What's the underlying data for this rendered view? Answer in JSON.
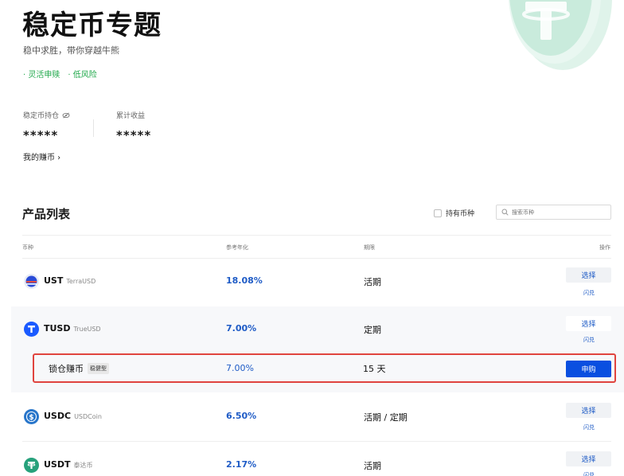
{
  "hero": {
    "title": "稳定币专题",
    "subtitle": "稳中求胜，带你穿越牛熊",
    "tags": [
      "灵活申赎",
      "低风险"
    ]
  },
  "holdings": {
    "holding_label": "稳定币持仓",
    "holding_value": "*****",
    "earnings_label": "累计收益",
    "earnings_value": "*****",
    "my_earn_link": "我的赚币 ›"
  },
  "products": {
    "title": "产品列表",
    "filter_label": "持有币种",
    "search_placeholder": "搜索币种",
    "columns": {
      "coin": "币种",
      "apy": "参考年化",
      "term": "期限",
      "action": "操作"
    },
    "rows": [
      {
        "symbol": "UST",
        "name": "TerraUSD",
        "apy": "18.08%",
        "term": "活期",
        "choose": "选择",
        "flash": "闪兑"
      },
      {
        "symbol": "TUSD",
        "name": "TrueUSD",
        "apy": "7.00%",
        "term": "定期",
        "choose": "选择",
        "flash": "闪兑"
      },
      {
        "symbol": "USDC",
        "name": "USDCoin",
        "apy": "6.50%",
        "term": "活期 / 定期",
        "choose": "选择",
        "flash": "闪兑"
      },
      {
        "symbol": "USDT",
        "name": "泰达币",
        "apy": "2.17%",
        "term": "活期",
        "choose": "选择",
        "flash": "闪兑"
      }
    ],
    "sub_row": {
      "name": "锁仓赚币",
      "badge": "稳健型",
      "apy": "7.00%",
      "term": "15 天",
      "buy": "申购"
    }
  },
  "colors": {
    "accent_blue": "#1e5bc6",
    "buy_button": "#0a4fe0",
    "tag_green": "#1fa84a",
    "highlight_border": "#e0443e",
    "tether_green": "#26a17b",
    "tusd_blue": "#1a5aff",
    "usdc_blue": "#2775ca"
  },
  "icons": {
    "hero_coin": "tether-coin-icon",
    "hide": "eye-slash-icon",
    "search": "search-icon",
    "ust": "ust-coin-icon",
    "tusd": "tusd-coin-icon",
    "usdc": "usdc-coin-icon",
    "usdt": "usdt-coin-icon"
  }
}
